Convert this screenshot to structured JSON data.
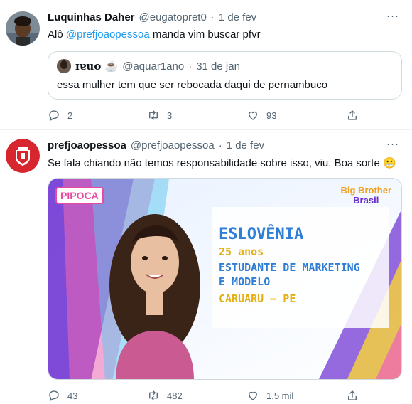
{
  "tweet1": {
    "name": "Luquinhas Daher",
    "handle": "@eugatopret0",
    "dot": "·",
    "date": "1 de fev",
    "text_prefix": "Alô ",
    "mention": "@prefjoaopessoa",
    "text_suffix": " manda vim buscar pfvr",
    "quote": {
      "name": "ɪɐuo ☕",
      "handle": "@aquar1ano",
      "dot": "·",
      "date": "31 de jan",
      "text": "essa mulher tem que ser rebocada daqui de pernambuco"
    },
    "replies": "2",
    "retweets": "3",
    "likes": "93"
  },
  "tweet2": {
    "name": "prefjoaopessoa",
    "handle": "@prefjoaopessoa",
    "dot": "·",
    "date": "1 de fev",
    "text": "Se fala chiando não temos responsabilidade sobre isso, viu. Boa sorte 😬",
    "media": {
      "tag": "PIPOCA",
      "logo_line1": "Big Brother",
      "logo_line2": "Brasil",
      "card_name": "ESLOVÊNIA",
      "card_age": "25 anos",
      "card_line1": "ESTUDANTE DE MARKETING",
      "card_line2": "E MODELO",
      "card_city": "CARUARU – PE"
    },
    "replies": "43",
    "retweets": "482",
    "likes": "1,5 mil"
  },
  "more_label": "···",
  "colors": {
    "accent": "#1d9bf0",
    "muted": "#536471",
    "border": "#cfd9de",
    "card_purple": "#6a2bd1",
    "card_yellow": "#f4d03f"
  },
  "icons": [
    "reply-icon",
    "retweet-icon",
    "like-icon",
    "share-icon",
    "more-icon"
  ]
}
